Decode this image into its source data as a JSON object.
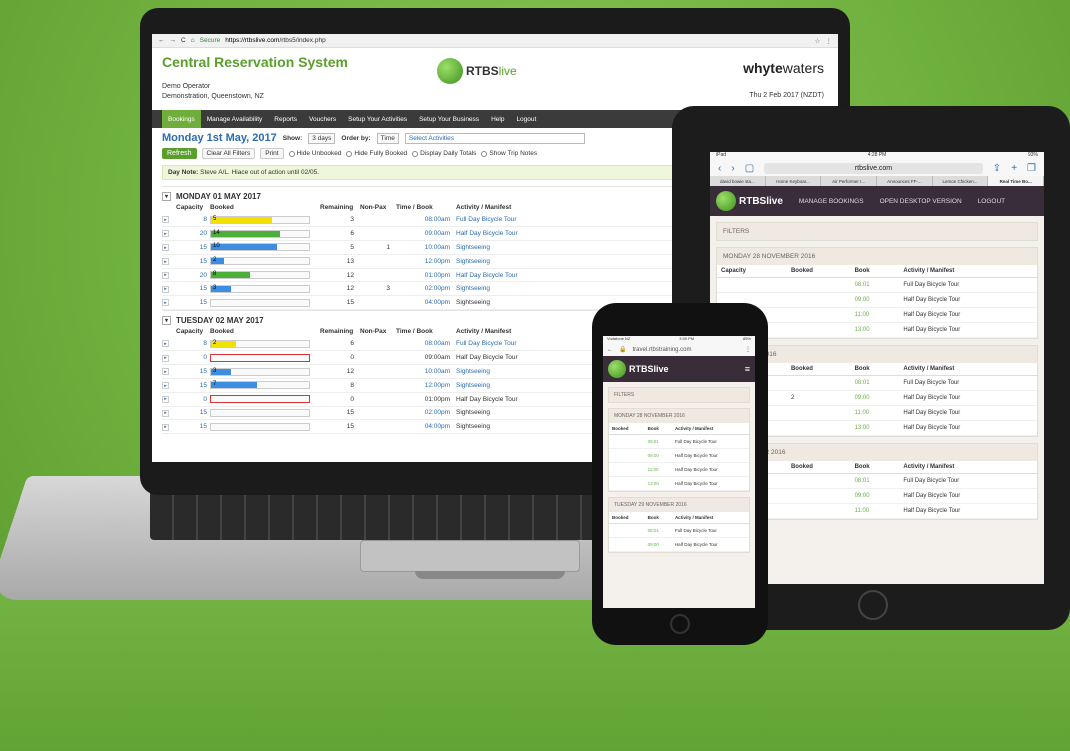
{
  "colors": {
    "brand_green": "#5a9f2c",
    "nav_dark": "#3b3b3b",
    "mobile_bar": "#3a2d3a",
    "link_blue": "#2b6cb0"
  },
  "desktop": {
    "browser": {
      "secure": "Secure",
      "url_host": "https://rtbslive.com",
      "url_path": "/rtbs5/index.php"
    },
    "app_title": "Central Reservation System",
    "operator_name": "Demo Operator",
    "operator_location": "Demonstration, Queenstown, NZ",
    "logo_text": "RTBS",
    "logo_text2": "live",
    "partner_logo_a": "whyte",
    "partner_logo_b": "waters",
    "current_date": "Thu 2 Feb 2017 (NZDT)",
    "nav": [
      "Bookings",
      "Manage Availability",
      "Reports",
      "Vouchers",
      "Setup Your Activities",
      "Setup Your Business",
      "Help",
      "Logout"
    ],
    "heading": "Monday 1st May, 2017",
    "show_label": "Show:",
    "show_value": "3 days",
    "order_label": "Order by:",
    "order_value": "Time",
    "activities_placeholder": "Select Activities",
    "refresh": "Refresh",
    "clear_filters": "Clear All Filters",
    "print": "Print",
    "opt_hide_unbooked": "Hide Unbooked",
    "opt_hide_full": "Hide Fully Booked",
    "opt_daily_totals": "Display Daily Totals",
    "opt_trip_notes": "Show Trip Notes",
    "note_label": "Day Note:",
    "note_text": "Steve A/L. Hiace out of action until 02/05.",
    "columns": [
      "Capacity",
      "Booked",
      "Remaining",
      "Non-Pax",
      "Time / Book",
      "Activity / Manifest"
    ],
    "days": [
      {
        "title": "MONDAY 01 MAY 2017",
        "rows": [
          {
            "cap": "8",
            "booked": "5",
            "fill": 0.62,
            "color": "#f2e000",
            "rem": "3",
            "nonpax": "",
            "time": "08:00am",
            "link": true,
            "activity": "Full Day Bicycle Tour",
            "act_link": true
          },
          {
            "cap": "20",
            "booked": "14",
            "fill": 0.7,
            "color": "#4caf3a",
            "rem": "6",
            "nonpax": "",
            "time": "09:00am",
            "link": true,
            "activity": "Half Day Bicycle Tour",
            "act_link": true
          },
          {
            "cap": "15",
            "booked": "10",
            "fill": 0.67,
            "color": "#3d8de0",
            "rem": "5",
            "nonpax": "1",
            "time": "10:00am",
            "link": true,
            "activity": "Sightseeing",
            "act_link": true
          },
          {
            "cap": "15",
            "booked": "2",
            "fill": 0.13,
            "color": "#3d8de0",
            "rem": "13",
            "nonpax": "",
            "time": "12:00pm",
            "link": true,
            "activity": "Sightseeing",
            "act_link": true
          },
          {
            "cap": "20",
            "booked": "8",
            "fill": 0.4,
            "color": "#4caf3a",
            "rem": "12",
            "nonpax": "",
            "time": "01:00pm",
            "link": true,
            "activity": "Half Day Bicycle Tour",
            "act_link": true
          },
          {
            "cap": "15",
            "booked": "3",
            "fill": 0.2,
            "color": "#3d8de0",
            "rem": "12",
            "nonpax": "3",
            "time": "02:00pm",
            "link": true,
            "activity": "Sightseeing",
            "act_link": true
          },
          {
            "cap": "15",
            "booked": "",
            "fill": 0,
            "color": "#3d8de0",
            "rem": "15",
            "nonpax": "",
            "time": "04:00pm",
            "link": true,
            "activity": "Sightseeing",
            "act_link": false
          }
        ]
      },
      {
        "title": "TUESDAY 02 MAY 2017",
        "rows": [
          {
            "cap": "8",
            "booked": "2",
            "fill": 0.25,
            "color": "#f2e000",
            "rem": "6",
            "nonpax": "",
            "time": "08:00am",
            "link": true,
            "activity": "Full Day Bicycle Tour",
            "act_link": true
          },
          {
            "cap": "0",
            "booked": "",
            "fill": 0,
            "color": "#d33",
            "rem": "0",
            "nonpax": "",
            "time": "09:00am",
            "link": false,
            "activity": "Half Day Bicycle Tour",
            "act_link": false,
            "full": true
          },
          {
            "cap": "15",
            "booked": "3",
            "fill": 0.2,
            "color": "#3d8de0",
            "rem": "12",
            "nonpax": "",
            "time": "10:00am",
            "link": true,
            "activity": "Sightseeing",
            "act_link": true
          },
          {
            "cap": "15",
            "booked": "7",
            "fill": 0.47,
            "color": "#3d8de0",
            "rem": "8",
            "nonpax": "",
            "time": "12:00pm",
            "link": true,
            "activity": "Sightseeing",
            "act_link": true
          },
          {
            "cap": "0",
            "booked": "",
            "fill": 0,
            "color": "#d33",
            "rem": "0",
            "nonpax": "",
            "time": "01:00pm",
            "link": false,
            "activity": "Half Day Bicycle Tour",
            "act_link": false,
            "full": true
          },
          {
            "cap": "15",
            "booked": "",
            "fill": 0,
            "color": "#3d8de0",
            "rem": "15",
            "nonpax": "",
            "time": "02:00pm",
            "link": true,
            "activity": "Sightseeing",
            "act_link": false
          },
          {
            "cap": "15",
            "booked": "",
            "fill": 0,
            "color": "#3d8de0",
            "rem": "15",
            "nonpax": "",
            "time": "04:00pm",
            "link": true,
            "activity": "Sightseeing",
            "act_link": false
          }
        ]
      }
    ]
  },
  "tablet": {
    "status_left": "iPad",
    "status_time": "4:28 PM",
    "status_right": "93%",
    "url": "rtbslive.com",
    "tabs": [
      "david bowie sta...",
      "Home Keyboar...",
      "Air Performer I...",
      "Announces FF-...",
      "Lemon Chicken...",
      "Real Time Bo..."
    ],
    "brand": "RTBSlive",
    "menu": [
      "MANAGE BOOKINGS",
      "OPEN DESKTOP VERSION",
      "LOGOUT"
    ],
    "filters": "FILTERS",
    "columns": [
      "Capacity",
      "Booked",
      "Book",
      "Activity / Manifest"
    ],
    "days": [
      {
        "title": "MONDAY 28 NOVEMBER 2016",
        "rows": [
          {
            "booked": "",
            "book": "08:01",
            "activity": "Full Day Bicycle Tour"
          },
          {
            "booked": "",
            "book": "09:00",
            "activity": "Half Day Bicycle Tour"
          },
          {
            "booked": "",
            "book": "11:00",
            "activity": "Half Day Bicycle Tour"
          },
          {
            "booked": "",
            "book": "13:00",
            "activity": "Half Day Bicycle Tour"
          }
        ]
      },
      {
        "title": "NOVEMBER 2016",
        "rows": [
          {
            "booked": "",
            "book": "08:01",
            "activity": "Full Day Bicycle Tour"
          },
          {
            "booked": "2",
            "book": "09:00",
            "activity": "Half Day Bicycle Tour"
          },
          {
            "booked": "",
            "book": "11:00",
            "activity": "Half Day Bicycle Tour"
          },
          {
            "booked": "",
            "book": "13:00",
            "activity": "Half Day Bicycle Tour"
          }
        ]
      },
      {
        "title": "30 NOVEMBER 2016",
        "rows": [
          {
            "booked": "",
            "book": "08:01",
            "activity": "Full Day Bicycle Tour"
          },
          {
            "booked": "",
            "book": "09:00",
            "activity": "Half Day Bicycle Tour"
          },
          {
            "booked": "",
            "book": "11:00",
            "activity": "Half Day Bicycle Tour"
          }
        ]
      }
    ]
  },
  "phone": {
    "status_left": "Vodafone NZ",
    "status_time": "3:39 PM",
    "status_right": "85%",
    "url": "travel.rtbstraining.com",
    "brand": "RTBSlive",
    "filters": "FILTERS",
    "columns": [
      "Booked",
      "Book",
      "Activity / Manifest"
    ],
    "days": [
      {
        "title": "MONDAY 28 NOVEMBER 2016",
        "rows": [
          {
            "booked": "",
            "book": "08:01",
            "activity": "Full Day Bicycle Tour"
          },
          {
            "booked": "",
            "book": "09:00",
            "activity": "Half Day Bicycle Tour"
          },
          {
            "booked": "",
            "book": "11:00",
            "activity": "Half Day Bicycle Tour"
          },
          {
            "booked": "",
            "book": "13:00",
            "activity": "Half Day Bicycle Tour"
          }
        ]
      },
      {
        "title": "TUESDAY 29 NOVEMBER 2016",
        "rows": [
          {
            "booked": "",
            "book": "08:01",
            "activity": "Full Day Bicycle Tour"
          },
          {
            "booked": "",
            "book": "09:00",
            "activity": "Half Day Bicycle Tour"
          }
        ]
      }
    ]
  }
}
